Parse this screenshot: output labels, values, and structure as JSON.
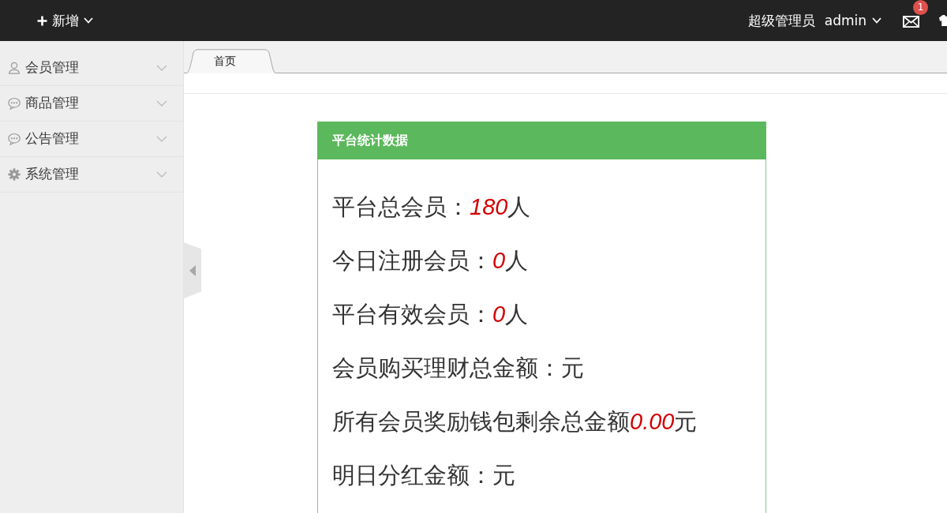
{
  "top_bar": {
    "add_menu": {
      "label": "新增"
    },
    "user": {
      "role": "超级管理员",
      "name": "admin"
    },
    "messages": {
      "badge": "1"
    }
  },
  "sidebar": {
    "items": [
      {
        "kind": "user",
        "label": "会员管理",
        "expanded": false
      },
      {
        "kind": "chat",
        "label": "商品管理",
        "expanded": false
      },
      {
        "kind": "chat",
        "label": "公告管理",
        "expanded": false
      },
      {
        "kind": "gear",
        "label": "系统管理",
        "expanded": false
      }
    ]
  },
  "tabs": [
    {
      "label": "首页",
      "selected": true
    }
  ],
  "stats_panel": {
    "title": "平台统计数据",
    "lines": [
      {
        "label": "平台总会员：",
        "value": "180",
        "unit": "人"
      },
      {
        "label": "今日注册会员：",
        "value": "0",
        "unit": "人"
      },
      {
        "label": "平台有效会员：",
        "value": "0",
        "unit": "人"
      },
      {
        "label": "会员购买理财总金额：",
        "unit": "元"
      },
      {
        "label": "所有会员奖励钱包剩余总金额",
        "value": "0.00",
        "unit": "元"
      },
      {
        "label": "明日分红金额：",
        "unit": "元"
      }
    ]
  }
}
